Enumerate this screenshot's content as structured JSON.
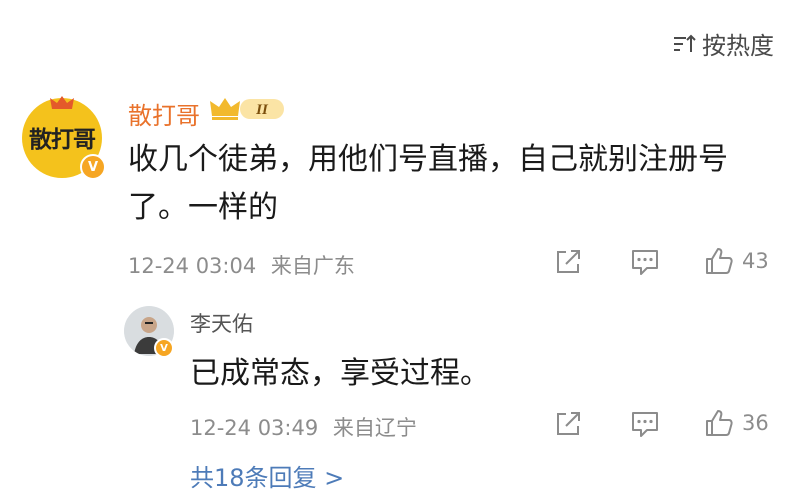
{
  "sort": {
    "label": "按热度",
    "icon": "sort-icon"
  },
  "comment": {
    "username": "散打哥",
    "vip_level": "II",
    "avatar_text": "散打哥",
    "verified": "V",
    "content": "收几个徒弟，用他们号直播，自己就别注册号了。一样的",
    "time": "12-24 03:04",
    "source": "来自广东",
    "likes": "43",
    "colors": {
      "username": "#e9722b",
      "avatar_bg": "#f4c21c"
    }
  },
  "reply": {
    "username": "李天佑",
    "verified": "V",
    "content": "已成常态，享受过程。",
    "time": "12-24 03:49",
    "source": "来自辽宁",
    "likes": "36"
  },
  "more_replies": "共18条回复 >",
  "icons": [
    "share-icon",
    "comment-icon",
    "like-icon"
  ],
  "link_color": "#4d7bb8"
}
